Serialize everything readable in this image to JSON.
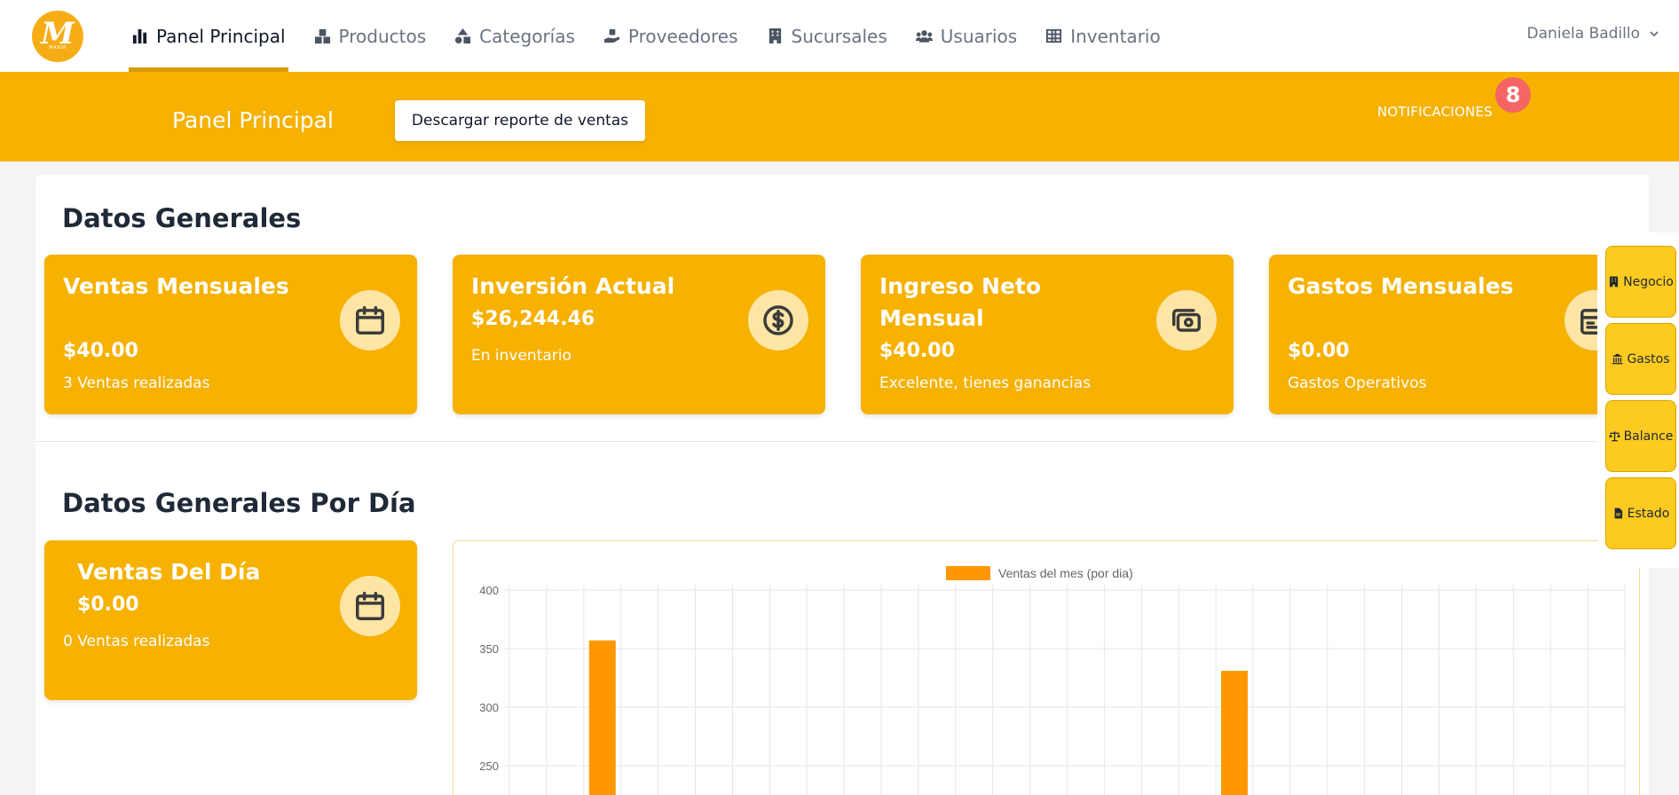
{
  "app": {
    "logo_text": "M",
    "logo_subtext": "MAXIM"
  },
  "nav": {
    "items": [
      {
        "label": "Panel Principal",
        "icon": "bar-chart-icon",
        "active": true
      },
      {
        "label": "Productos",
        "icon": "boxes-icon"
      },
      {
        "label": "Categorías",
        "icon": "shapes-icon"
      },
      {
        "label": "Proveedores",
        "icon": "hand-holding-icon"
      },
      {
        "label": "Sucursales",
        "icon": "building-icon"
      },
      {
        "label": "Usuarios",
        "icon": "users-icon"
      },
      {
        "label": "Inventario",
        "icon": "table-icon"
      }
    ],
    "user_name": "Daniela Badillo"
  },
  "header": {
    "title": "Panel Principal",
    "download_button": "Descargar reporte de ventas",
    "notifications_label": "NOTIFICACIONES",
    "notifications_count": "8"
  },
  "general": {
    "title": "Datos Generales",
    "cards": [
      {
        "title": "Ventas Mensuales",
        "value": "$40.00",
        "sub": "3 Ventas realizadas",
        "icon": "calendar-icon"
      },
      {
        "title": "Inversión Actual",
        "value": "$26,244.46",
        "sub": "En inventario",
        "icon": "dollar-circle-icon"
      },
      {
        "title": "Ingreso Neto Mensual",
        "value": "$40.00",
        "sub": "Excelente, tienes ganancias",
        "icon": "money-icon"
      },
      {
        "title": "Gastos Mensuales",
        "value": "$0.00",
        "sub": "Gastos Operativos",
        "icon": "calendar-icon"
      }
    ]
  },
  "daily": {
    "title": "Datos Generales Por Día",
    "card": {
      "title": "Ventas Del Día",
      "value": "$0.00",
      "sub": "0 Ventas realizadas",
      "icon": "calendar-icon"
    }
  },
  "side_buttons": [
    {
      "label": "Negocio",
      "icon": "building-icon"
    },
    {
      "label": "Gastos",
      "icon": "bank-icon"
    },
    {
      "label": "Balance",
      "icon": "scale-icon"
    },
    {
      "label": "Estado",
      "icon": "file-icon"
    }
  ],
  "colors": {
    "accent": "#f6b101",
    "bar": "#ff9800",
    "badge": "#f56565"
  },
  "chart_data": {
    "type": "bar",
    "legend": "Ventas del mes (por dia)",
    "legend_position": "top",
    "ylim": [
      200,
      400
    ],
    "yticks": [
      400,
      350,
      300,
      250
    ],
    "x_slots": 30,
    "bars": [
      {
        "slot": 2,
        "value": 357
      },
      {
        "slot": 19,
        "value": 331
      }
    ],
    "grid": true
  }
}
